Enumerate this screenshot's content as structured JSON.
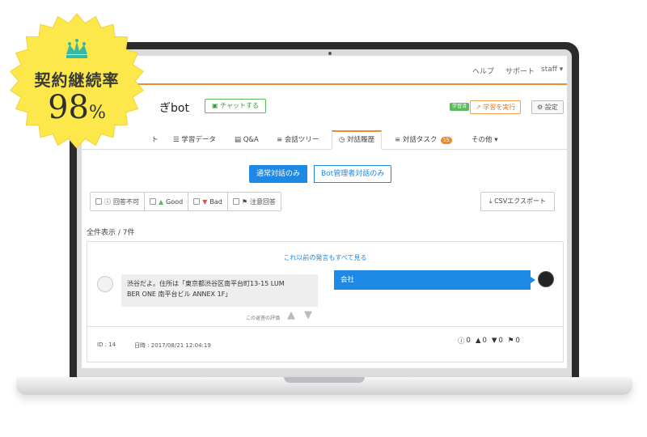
{
  "badge": {
    "title": "契約継続率",
    "value": "98",
    "unit": "%"
  },
  "topnav": {
    "help": "ヘルプ",
    "support": "サポート",
    "user": "staff ▾"
  },
  "bot": {
    "title_fragment": "ぎbot",
    "chat_button": "チャットする"
  },
  "learning": {
    "status_badge": "学習済",
    "run_button": "学習を実行",
    "settings_button": "設定"
  },
  "tabs": [
    {
      "label": "ト",
      "active": false
    },
    {
      "label": "学習データ",
      "active": false
    },
    {
      "label": "Q&A",
      "active": false
    },
    {
      "label": "会話ツリー",
      "active": false
    },
    {
      "label": "対話履歴",
      "active": true
    },
    {
      "label": "対話タスク",
      "badge": "15",
      "active": false
    },
    {
      "label": "その他 ▾",
      "active": false
    }
  ],
  "segments": {
    "normal": "通常対話のみ",
    "admin": "Bot管理者対話のみ"
  },
  "filters": [
    {
      "label": "回答不可"
    },
    {
      "label": "Good"
    },
    {
      "label": "Bad"
    },
    {
      "label": "注意回答"
    }
  ],
  "csv_export": "CSVエクスポート",
  "count_text": "全件表示 / 7件",
  "conversation": {
    "more_link": "これ以前の発言もすべて見る",
    "user_message_line1": "渋谷だよ。住所は「東京都渋谷区南平台町13-15 LUM",
    "user_message_line2": "BER ONE 南平台ビル ANNEX 1F」",
    "rating_label": "この返答の評価",
    "bot_message": "会社",
    "id_text": "ID : 14",
    "datetime_text": "日時 : 2017/08/21 12:04:19",
    "stats": {
      "unanswerable": "0",
      "good": "0",
      "bad": "0",
      "flag": "0"
    }
  },
  "colors": {
    "accent": "#f08a2c",
    "primary": "#1e88e5",
    "good": "#5cb85c",
    "bad": "#d9534f",
    "badge_yellow": "#fce84a"
  }
}
